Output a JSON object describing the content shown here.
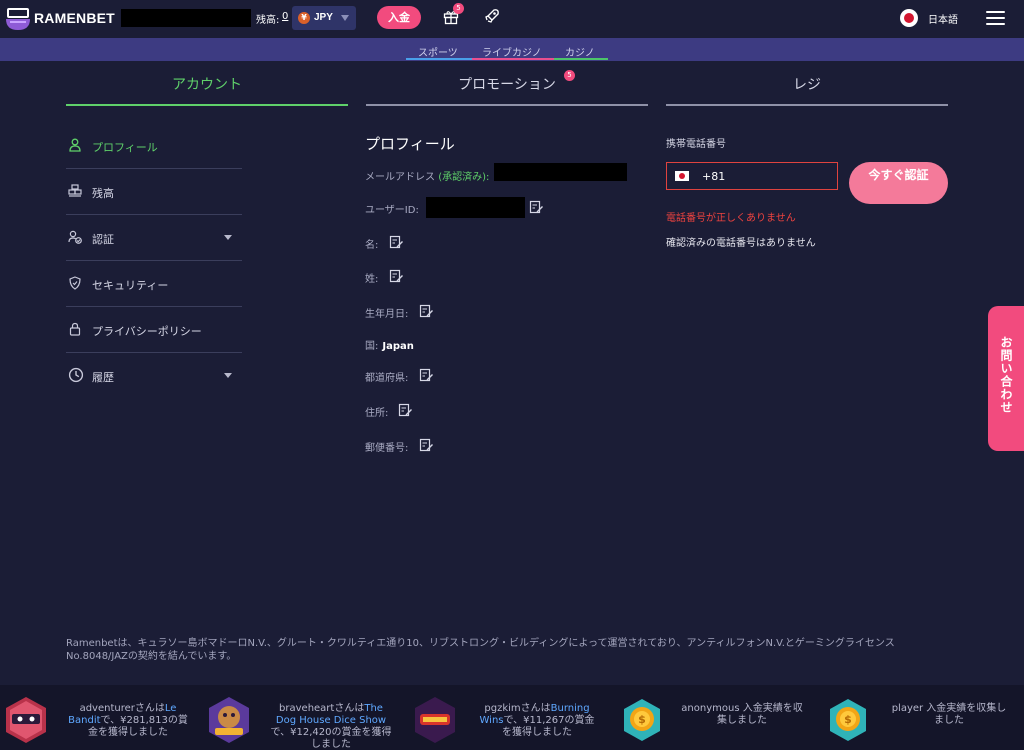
{
  "header": {
    "logo_text": "RAMENBET",
    "balance_label": "残高:",
    "balance_value": "0",
    "currency": "JPY",
    "currency_symbol": "¥",
    "deposit_label": "入金",
    "gift_badge": "5",
    "language": "日本語"
  },
  "subnav": {
    "sports": "スポーツ",
    "live_casino": "ライブカジノ",
    "casino": "カジノ"
  },
  "tabs": {
    "account": "アカウント",
    "promotion": "プロモーション",
    "promotion_badge": "5",
    "cashier": "レジ"
  },
  "sidebar": {
    "items": [
      {
        "label": "プロフィール"
      },
      {
        "label": "残高"
      },
      {
        "label": "認証"
      },
      {
        "label": "セキュリティー"
      },
      {
        "label": "プライバシーポリシー"
      },
      {
        "label": "履歴"
      }
    ]
  },
  "profile": {
    "title": "プロフィール",
    "email_label": "メールアドレス",
    "email_verified": "(承認済み):",
    "user_id_label": "ユーザーID:",
    "first_name_label": "名:",
    "last_name_label": "姓:",
    "birthdate_label": "生年月日:",
    "country_label": "国:",
    "country_value": "Japan",
    "prefecture_label": "都道府県:",
    "address_label": "住所:",
    "postal_label": "郵便番号:"
  },
  "cashier": {
    "phone_label": "携帯電話番号",
    "phone_code": "+81",
    "verify_button": "今すぐ認証",
    "error": "電話番号が正しくありません",
    "no_verified": "確認済みの電話番号はありません"
  },
  "contact_tab": "お問い合わせ",
  "legal": "Ramenbetは、キュラソー島ボマドーロN.V.、グルート・クワルティエ通り10、リブストロング・ビルディングによって運営されており、アンティルフォンN.V.とゲーミングライセンスNo.8048/JAZの契約を結んでいます。",
  "winners": [
    {
      "line1": "adventurerさんは",
      "game": "Le Bandit",
      "line2": "で、¥281,813の賞金を獲得しました"
    },
    {
      "line1": "braveheartさんは",
      "game": "The Dog House Dice Show",
      "line2": "で、¥12,420の賞金を獲得しました"
    },
    {
      "line1": "pgzkimさんは",
      "game": "Burning Wins",
      "line2": "で、¥11,267の賞金を獲得しました"
    },
    {
      "line1": "anonymous 入金実績を収集しました",
      "game": "",
      "line2": ""
    },
    {
      "line1": "player 入金実績を収集しました",
      "game": "",
      "line2": ""
    }
  ],
  "colors": {
    "background": "#1b1d36",
    "accent_pink": "#f24b7e",
    "accent_green": "#5fd16a",
    "subnav": "#3d3b82"
  }
}
